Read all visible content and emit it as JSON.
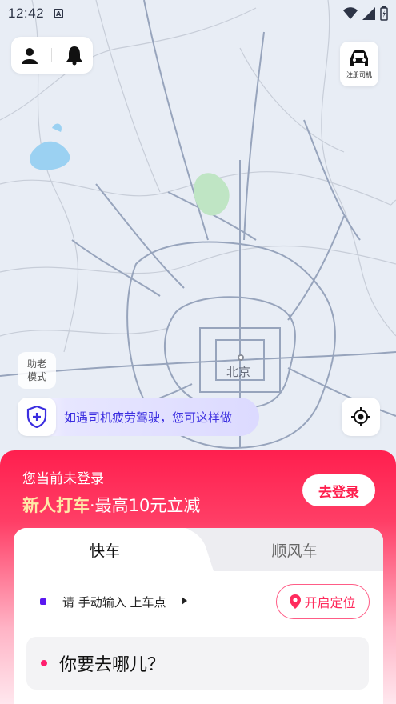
{
  "status_bar": {
    "time": "12:42",
    "notification": "A"
  },
  "top_actions": {
    "profile": "person-icon",
    "notifications": "bell-icon"
  },
  "driver_register": {
    "label": "注册司机"
  },
  "elder_mode": {
    "line1": "助老",
    "line2": "模式"
  },
  "map": {
    "city_label": "北京"
  },
  "safety_banner": {
    "text": "如遇司机疲劳驾驶，您可这样做"
  },
  "login_panel": {
    "note": "您当前未登录",
    "promo_highlight": "新人打车",
    "promo_rest": "·最高10元立减",
    "login_button": "去登录"
  },
  "tabs": [
    {
      "label": "快车",
      "active": true
    },
    {
      "label": "顺风车",
      "active": false
    }
  ],
  "pickup": {
    "text": "请 手动输入 上车点",
    "locate_button": "开启定位"
  },
  "destination": {
    "placeholder": "你要去哪儿？"
  },
  "colors": {
    "accent": "#ff1f4e",
    "safety_text": "#3b2ee0",
    "pickup_dot": "#5a18f0"
  }
}
